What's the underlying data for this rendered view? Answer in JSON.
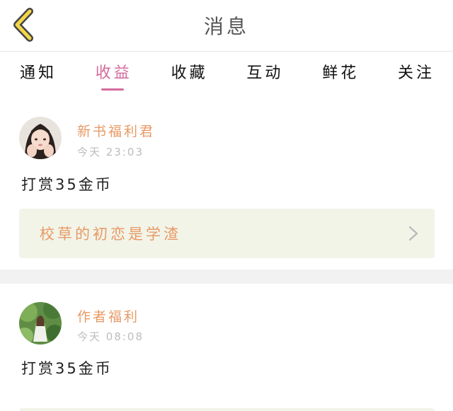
{
  "header": {
    "title": "消息",
    "back_icon": "back-chevron-icon"
  },
  "tabs": [
    {
      "label": "通知",
      "active": false
    },
    {
      "label": "收益",
      "active": true
    },
    {
      "label": "收藏",
      "active": false
    },
    {
      "label": "互动",
      "active": false
    },
    {
      "label": "鲜花",
      "active": false
    },
    {
      "label": "关注",
      "active": false
    }
  ],
  "messages": [
    {
      "sender": "新书福利君",
      "time": "今天 23:03",
      "text": "打赏35金币",
      "book_title": "校草的初恋是学渣"
    },
    {
      "sender": "作者福利",
      "time": "今天 08:08",
      "text": "打赏35金币"
    }
  ],
  "colors": {
    "accent_pink": "#d56b9c",
    "name_orange": "#e89a66",
    "back_yellow": "#f3d54a",
    "book_bg": "#f2f4e8"
  }
}
